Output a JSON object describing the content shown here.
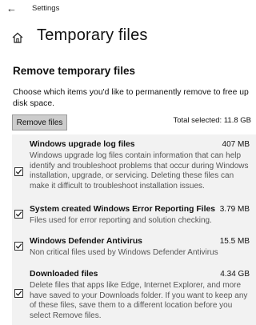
{
  "window": {
    "back_glyph": "←",
    "app_title": "Settings"
  },
  "header": {
    "page_title": "Temporary files"
  },
  "section": {
    "heading": "Remove temporary files",
    "description": "Choose which items you'd like to permanently remove to free up disk space.",
    "remove_button_label": "Remove files",
    "total_selected": "Total selected: 11.8 GB"
  },
  "items": [
    {
      "name": "Windows upgrade log files",
      "size": "407 MB",
      "checked": true,
      "description": "Windows upgrade log files contain information that can help identify and troubleshoot problems that occur during Windows installation, upgrade, or servicing.  Deleting these files can make it difficult to troubleshoot installation issues."
    },
    {
      "name": "System created Windows Error Reporting Files",
      "size": "3.79 MB",
      "checked": true,
      "description": "Files used for error reporting and solution checking."
    },
    {
      "name": "Windows Defender Antivirus",
      "size": "15.5 MB",
      "checked": true,
      "description": "Non critical files used by Windows Defender Antivirus"
    },
    {
      "name": "Downloaded files",
      "size": "4.34 GB",
      "checked": true,
      "description": "Delete files that apps like Edge, Internet Explorer, and more have saved to your Downloads folder. If you want to keep any of these files, save them to a different location before you select Remove files."
    }
  ],
  "icons": {
    "back": "back-arrow-icon",
    "home": "home-icon",
    "checkbox": "checkmark-icon"
  }
}
